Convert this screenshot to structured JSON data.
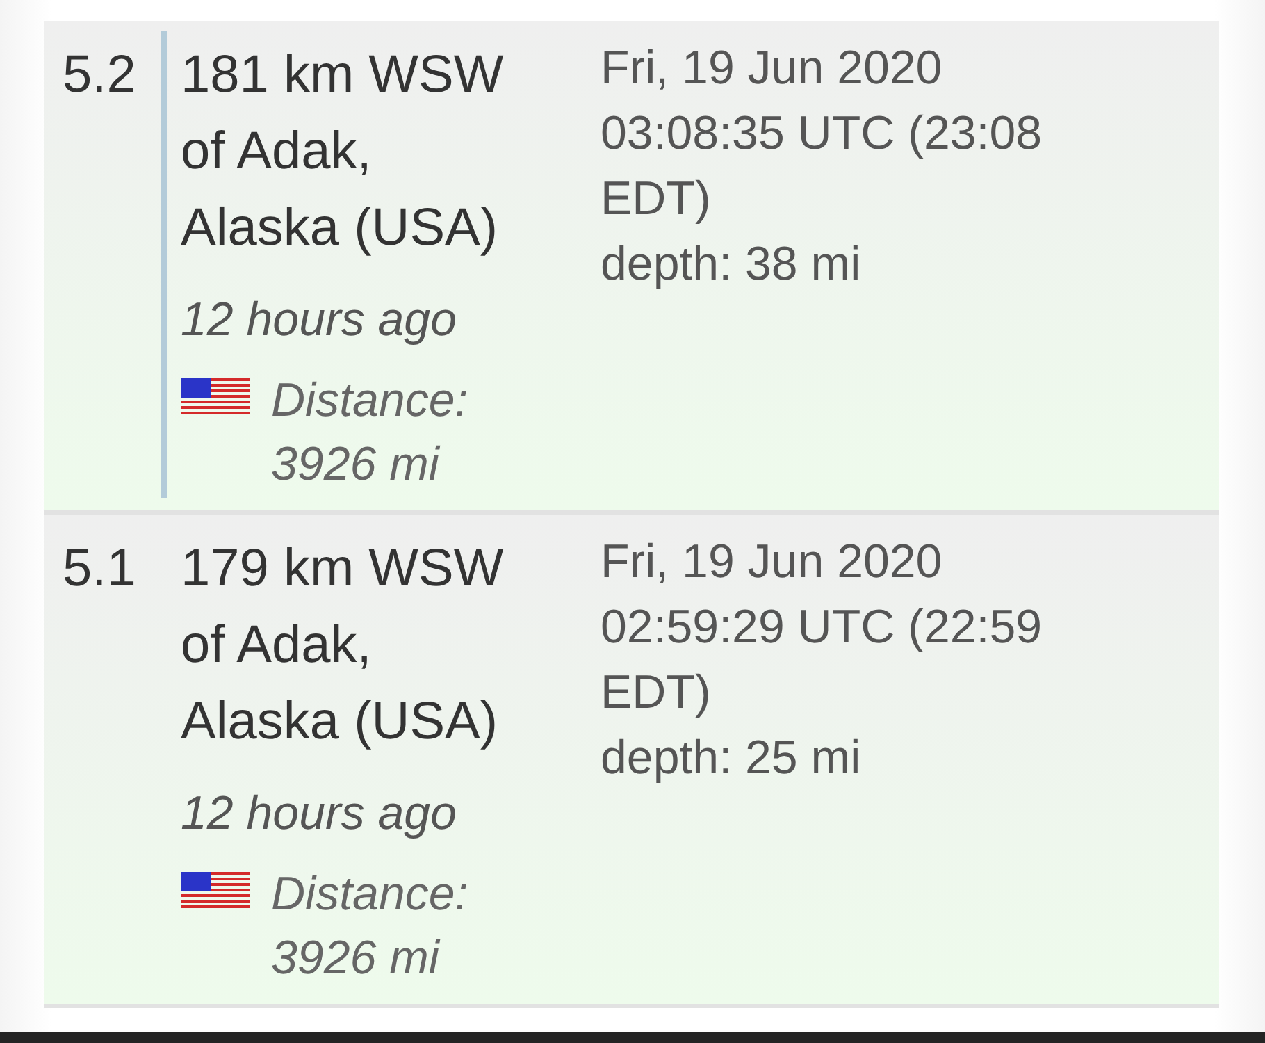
{
  "quakes": [
    {
      "magnitude": "5.2",
      "selected": true,
      "location": "181 km WSW of Adak, Alaska (USA)",
      "ago": "12 hours ago",
      "distance": "Distance: 3926 mi",
      "date": "Fri, 19 Jun 2020",
      "time": "03:08:35 UTC (23:08 EDT)",
      "depth": "depth: 38 mi"
    },
    {
      "magnitude": "5.1",
      "selected": false,
      "location": "179 km WSW of Adak, Alaska (USA)",
      "ago": "12 hours ago",
      "distance": "Distance: 3926 mi",
      "date": "Fri, 19 Jun 2020",
      "time": "02:59:29 UTC (22:59 EDT)",
      "depth": "depth: 25 mi"
    }
  ]
}
